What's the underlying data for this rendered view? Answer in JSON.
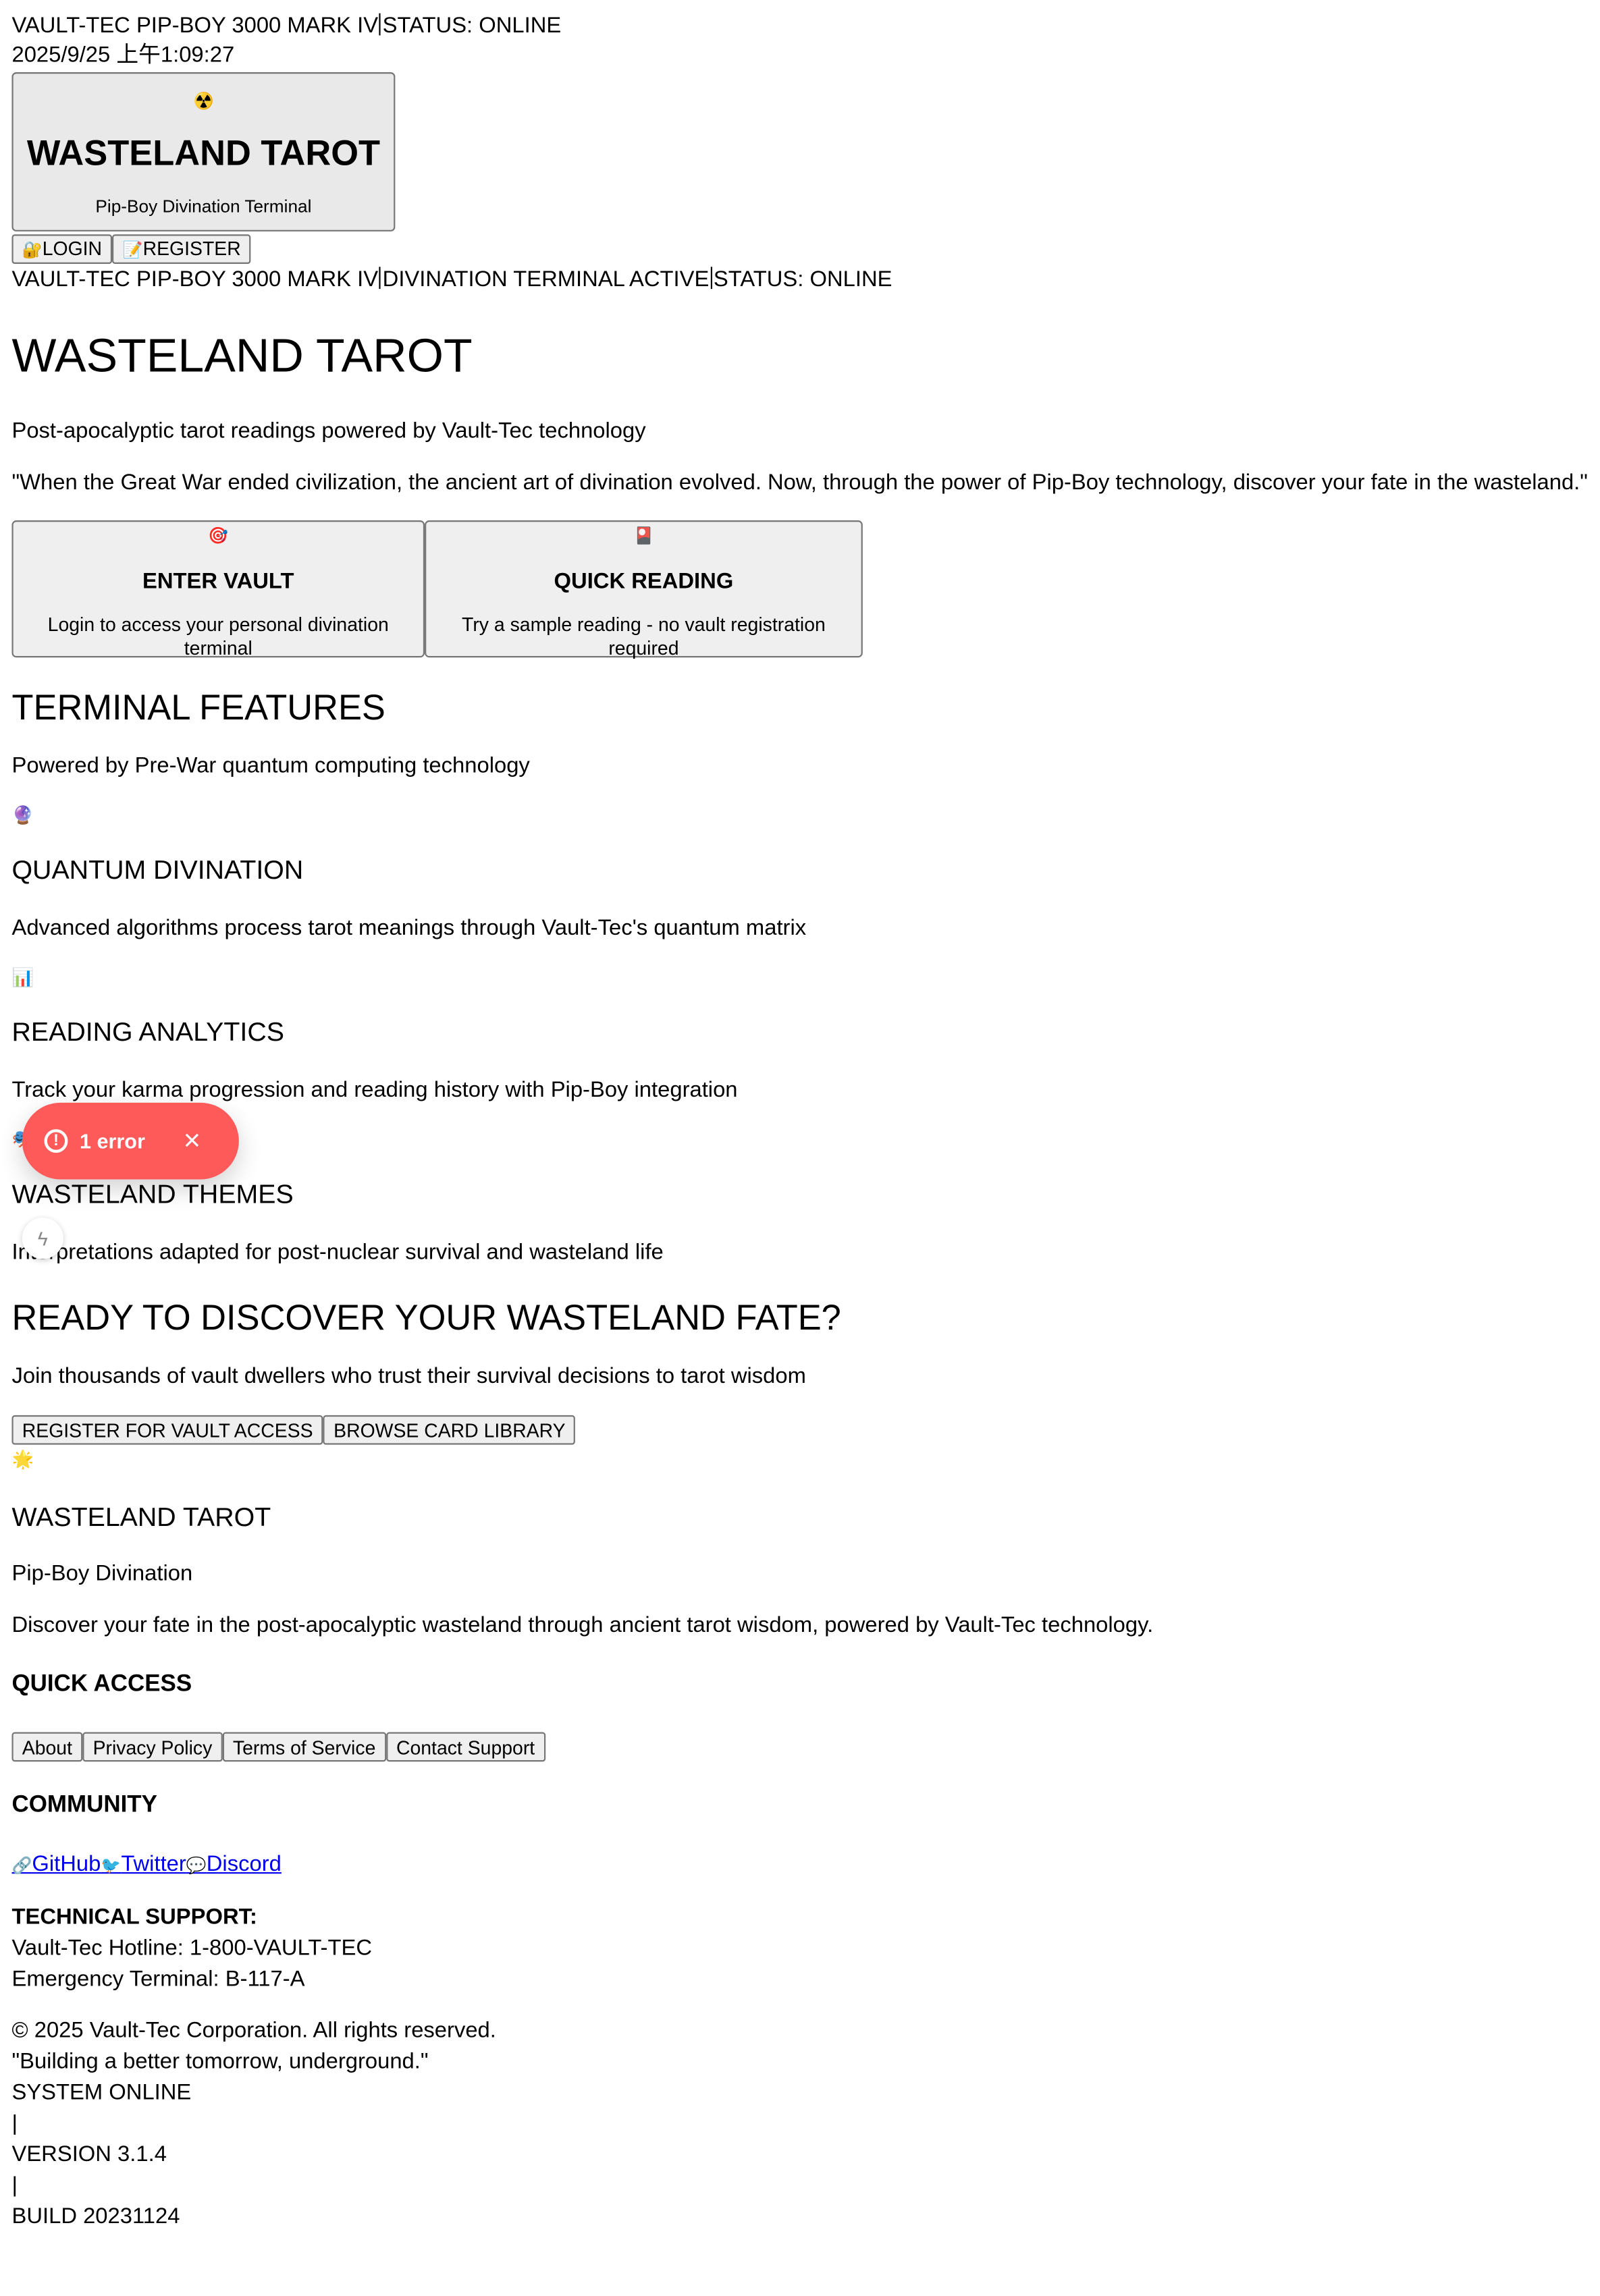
{
  "status_bar": {
    "system": "VAULT-TEC PIP-BOY 3000 MARK IV",
    "status": "STATUS: ONLINE",
    "datetime": "2025/9/25 上午1:09:27"
  },
  "logo": {
    "icon": "☢️",
    "title": "WASTELAND TAROT",
    "subtitle": "Pip-Boy Divination Terminal"
  },
  "auth": {
    "login_icon": "🔐",
    "login": "LOGIN",
    "register_icon": "📝",
    "register": "REGISTER"
  },
  "terminal_bar": {
    "system": "VAULT-TEC PIP-BOY 3000 MARK IV",
    "terminal": "DIVINATION TERMINAL ACTIVE",
    "status": "STATUS: ONLINE"
  },
  "hero": {
    "title": "WASTELAND TAROT",
    "tagline": "Post-apocalyptic tarot readings powered by Vault-Tec technology",
    "quote": "\"When the Great War ended civilization, the ancient art of divination evolved. Now, through the power of Pip-Boy technology, discover your fate in the wasteland.\""
  },
  "cta": {
    "enter_vault": {
      "icon": "🎯",
      "title": "ENTER VAULT",
      "subtitle": "Login to access your personal divination terminal"
    },
    "quick_reading": {
      "icon": "🎴",
      "title": "QUICK READING",
      "subtitle": "Try a sample reading - no vault registration required"
    }
  },
  "features": {
    "title": "TERMINAL FEATURES",
    "subtitle": "Powered by Pre-War quantum computing technology",
    "items": [
      {
        "icon": "🔮",
        "title": "QUANTUM DIVINATION",
        "desc": "Advanced algorithms process tarot meanings through Vault-Tec's quantum matrix"
      },
      {
        "icon": "📊",
        "title": "READING ANALYTICS",
        "desc": "Track your karma progression and reading history with Pip-Boy integration"
      },
      {
        "icon": "🎭",
        "title": "WASTELAND THEMES",
        "desc": "Interpretations adapted for post-nuclear survival and wasteland life"
      }
    ]
  },
  "ready": {
    "title": "READY TO DISCOVER YOUR WASTELAND FATE?",
    "subtitle": "Join thousands of vault dwellers who trust their survival decisions to tarot wisdom",
    "register_button": "REGISTER FOR VAULT ACCESS",
    "browse_button": "BROWSE CARD LIBRARY"
  },
  "footer": {
    "icon": "🌟",
    "brand": "WASTELAND TAROT",
    "brand_sub": "Pip-Boy Divination",
    "description": "Discover your fate in the post-apocalyptic wasteland through ancient tarot wisdom, powered by Vault-Tec technology.",
    "quick_access_title": "QUICK ACCESS",
    "quick_access": [
      "About",
      "Privacy Policy",
      "Terms of Service",
      "Contact Support"
    ],
    "community_title": "COMMUNITY",
    "community": [
      {
        "icon": "🔗",
        "label": "GitHub"
      },
      {
        "icon": "🐦",
        "label": "Twitter"
      },
      {
        "icon": "💬",
        "label": "Discord"
      }
    ],
    "support_title": "TECHNICAL SUPPORT:",
    "hotline": "Vault-Tec Hotline: 1-800-VAULT-TEC",
    "emergency": "Emergency Terminal: B-117-A",
    "copyright": "© 2025 Vault-Tec Corporation. All rights reserved.",
    "motto": "\"Building a better tomorrow, underground.\"",
    "system_status": "SYSTEM ONLINE",
    "divider": "|",
    "version": "VERSION 3.1.4",
    "build": "BUILD 20231124"
  },
  "dev_overlay": {
    "error_icon": "!",
    "error_text": "1 error",
    "close_icon": "×",
    "bolt_icon": "ϟ"
  },
  "colors": {
    "error_toast": "#ff5a5a",
    "link": "#0000ee",
    "button_bg": "#efefef",
    "button_border": "#767676"
  }
}
